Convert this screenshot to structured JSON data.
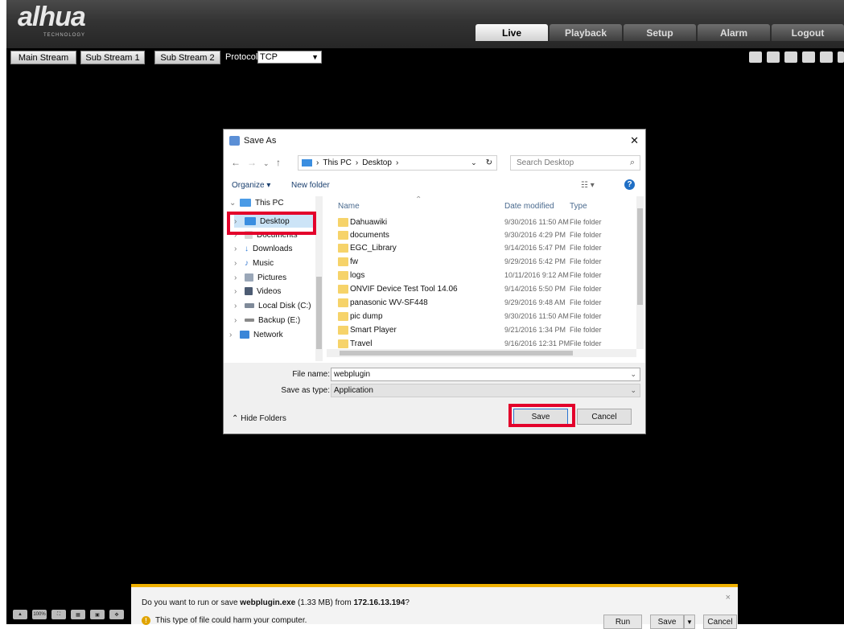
{
  "app": {
    "logo": "alhua",
    "logo_sub": "TECHNOLOGY",
    "tabs": [
      {
        "label": "Live",
        "active": true
      },
      {
        "label": "Playback",
        "active": false
      },
      {
        "label": "Setup",
        "active": false
      },
      {
        "label": "Alarm",
        "active": false
      },
      {
        "label": "Logout",
        "active": false
      }
    ],
    "stream_buttons": [
      "Main Stream",
      "Sub Stream 1",
      "Sub Stream 2"
    ],
    "protocol_label": "Protocol",
    "protocol_value": "TCP",
    "bottom_icons": [
      "100%",
      "⛶",
      "▦",
      "▣",
      "✥"
    ]
  },
  "dialog": {
    "title": "Save As",
    "close": "✕",
    "breadcrumb": [
      "This PC",
      "Desktop"
    ],
    "search_placeholder": "Search Desktop",
    "organize": "Organize ▾",
    "new_folder": "New folder",
    "tree": [
      {
        "label": "This PC",
        "color": "#4b9be6"
      },
      {
        "label": "Desktop",
        "color": "#3a8ee0"
      },
      {
        "label": "Documents",
        "color": "#d8d8d8"
      },
      {
        "label": "Downloads",
        "color": "#2c7bd6"
      },
      {
        "label": "Music",
        "color": "#3a7bd0"
      },
      {
        "label": "Pictures",
        "color": "#9aa7b8"
      },
      {
        "label": "Videos",
        "color": "#4d5c73"
      },
      {
        "label": "Local Disk (C:)",
        "color": "#7f8a99"
      },
      {
        "label": "Backup (E:)",
        "color": "#8a8a8a"
      },
      {
        "label": "Network",
        "color": "#3a86d8"
      }
    ],
    "columns": {
      "name": "Name",
      "date": "Date modified",
      "type": "Type"
    },
    "files": [
      {
        "name": "Dahuawiki",
        "date": "9/30/2016 11:50 AM",
        "type": "File folder"
      },
      {
        "name": "documents",
        "date": "9/30/2016 4:29 PM",
        "type": "File folder"
      },
      {
        "name": "EGC_Library",
        "date": "9/14/2016 5:47 PM",
        "type": "File folder"
      },
      {
        "name": "fw",
        "date": "9/29/2016 5:42 PM",
        "type": "File folder"
      },
      {
        "name": "logs",
        "date": "10/11/2016 9:12 AM",
        "type": "File folder"
      },
      {
        "name": "ONVIF Device Test Tool 14.06",
        "date": "9/14/2016 5:50 PM",
        "type": "File folder"
      },
      {
        "name": "panasonic WV-SF448",
        "date": "9/29/2016 9:48 AM",
        "type": "File folder"
      },
      {
        "name": "pic dump",
        "date": "9/30/2016 11:50 AM",
        "type": "File folder"
      },
      {
        "name": "Smart Player",
        "date": "9/21/2016 1:34 PM",
        "type": "File folder"
      },
      {
        "name": "Travel",
        "date": "9/16/2016 12:31 PM",
        "type": "File folder"
      }
    ],
    "file_name_label": "File name:",
    "file_name_value": "webplugin",
    "save_type_label": "Save as type:",
    "save_type_value": "Application",
    "hide_folders": "Hide Folders",
    "save": "Save",
    "cancel": "Cancel"
  },
  "download_bar": {
    "msg_prefix": "Do you want to run or save ",
    "file": "webplugin.exe",
    "size": " (1.33 MB) from ",
    "host": "172.16.13.194",
    "msg_suffix": "?",
    "warning": "This type of file could harm your computer.",
    "run": "Run",
    "save": "Save",
    "cancel": "Cancel",
    "close": "×"
  },
  "colors": {
    "highlight": "#e3002b",
    "download_bar_accent": "#f0b100"
  }
}
